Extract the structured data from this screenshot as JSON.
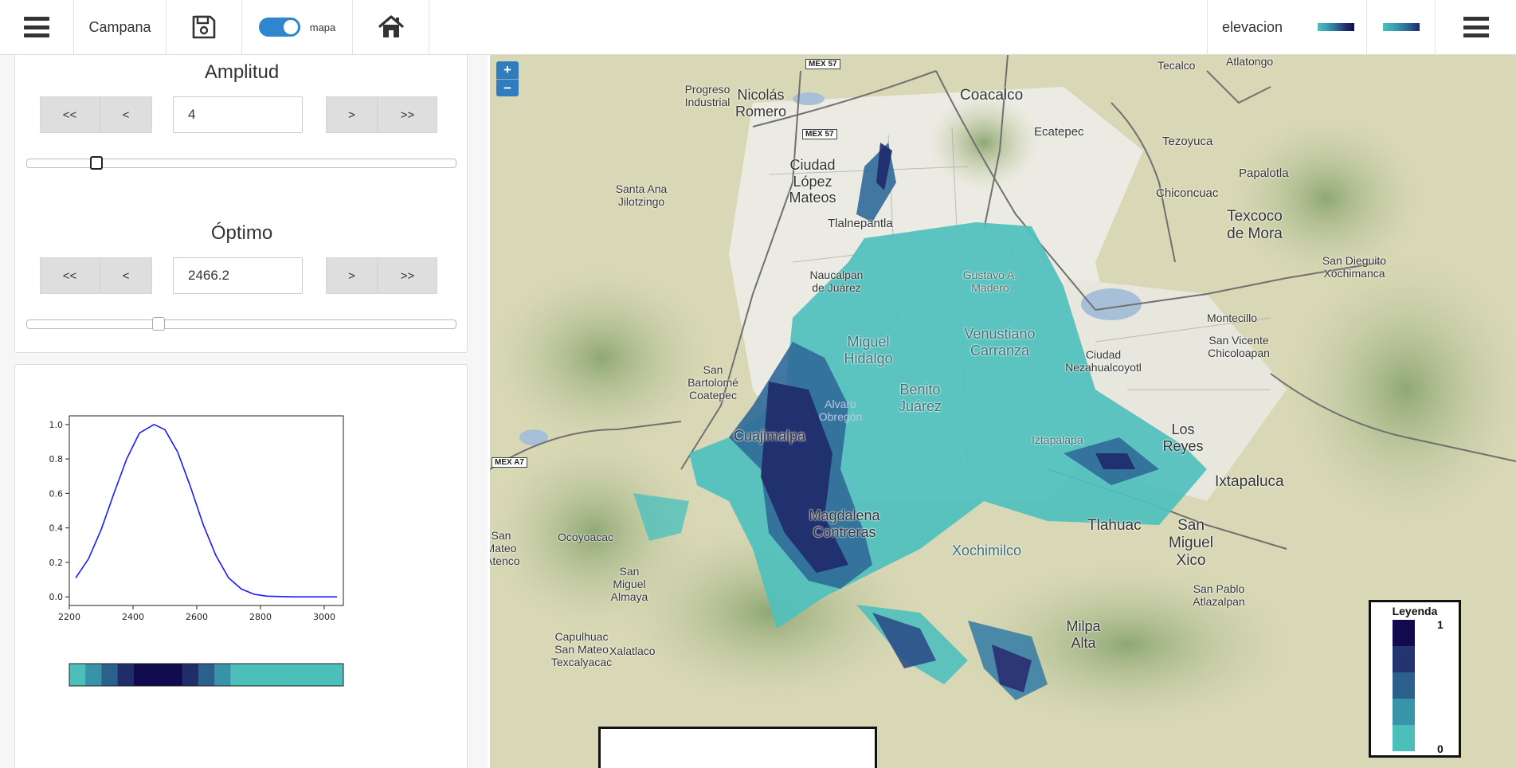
{
  "topbar": {
    "campana_label": "Campana",
    "toggle_label": "mapa",
    "layer_label": "elevacion"
  },
  "amplitud": {
    "title": "Amplitud",
    "btn_first": "<<",
    "btn_prev": "<",
    "value": "4",
    "btn_next": ">",
    "btn_last": ">>",
    "slider_fraction": 0.15
  },
  "optimo": {
    "title": "Óptimo",
    "btn_first": "<<",
    "btn_prev": "<",
    "value": "2466.2",
    "btn_next": ">",
    "btn_last": ">>",
    "slider_fraction": 0.3
  },
  "chart_data": {
    "type": "line",
    "title": "",
    "xlabel": "",
    "ylabel": "",
    "xlim": [
      2200,
      3060
    ],
    "ylim": [
      -0.05,
      1.05
    ],
    "xticks": [
      "2200",
      "2400",
      "2600",
      "2800",
      "3000"
    ],
    "yticks": [
      "0.0",
      "0.2",
      "0.4",
      "0.6",
      "0.8",
      "1.0"
    ],
    "series": [
      {
        "color": "#1a1aff",
        "x": [
          2220,
          2260,
          2300,
          2340,
          2380,
          2420,
          2466,
          2500,
          2540,
          2580,
          2620,
          2660,
          2700,
          2740,
          2780,
          2820,
          2900,
          2980,
          3040
        ],
        "y": [
          0.11,
          0.22,
          0.39,
          0.6,
          0.8,
          0.95,
          1.0,
          0.97,
          0.84,
          0.64,
          0.42,
          0.24,
          0.11,
          0.045,
          0.015,
          0.004,
          0.0,
          0.0,
          0.0
        ]
      }
    ],
    "grid": false
  },
  "color_strip": [
    "#4dbfbb",
    "#3893a8",
    "#2b5f8c",
    "#1f2e6b",
    "#120a4f",
    "#120a4f",
    "#120a4f",
    "#1f2e6b",
    "#2b5f8c",
    "#3893a8",
    "#4dbfbb",
    "#4dbfbb",
    "#4dbfbb",
    "#4dbfbb",
    "#4dbfbb",
    "#4dbfbb",
    "#4dbfbb"
  ],
  "map": {
    "zoom_in": "+",
    "zoom_out": "−",
    "legend": {
      "title": "Leyenda",
      "high": "1",
      "low": "0",
      "colors": [
        "#120a4f",
        "#24346f",
        "#2b5f8c",
        "#3895a9",
        "#4dbfbb"
      ]
    },
    "highways": [
      "MEX 57",
      "MEX 57",
      "MEX A7"
    ],
    "places": [
      "Progreso Industrial",
      "Nicolás Romero",
      "Coacalco",
      "Tecalco",
      "Atlatongo",
      "Ecatepec",
      "Tezoyuca",
      "Papalotla",
      "Ciudad López Mateos",
      "Santa Ana Jilotzingo",
      "Tlalnepantla",
      "Chiconcuac",
      "Texcoco de Mora",
      "San Dieguito Xochimanca",
      "Naucalpan de Juárez",
      "Gustavo A. Madero",
      "Montecillo",
      "Miguel Hidalgo",
      "Venustiano Carranza",
      "Ciudad Nezahualcoyotl",
      "San Vicente Chicoloapan",
      "San Bartolomé Coatepec",
      "Benito Juárez",
      "Alvaro Obregón",
      "Cuajimalpa",
      "Iztapalapa",
      "Los Reyes",
      "Ixtapaluca",
      "Magdalena Contreras",
      "Ocoyoacac",
      "Tlahuac",
      "San Miguel Xico",
      "Xochimilco",
      "San Miguel Almaya",
      "San Pablo Atlazalpan",
      "Milpa Alta",
      "Capulhuac San Mateo Texcalyacac",
      "Xalatlaco",
      "San Mateo Atenco"
    ]
  }
}
